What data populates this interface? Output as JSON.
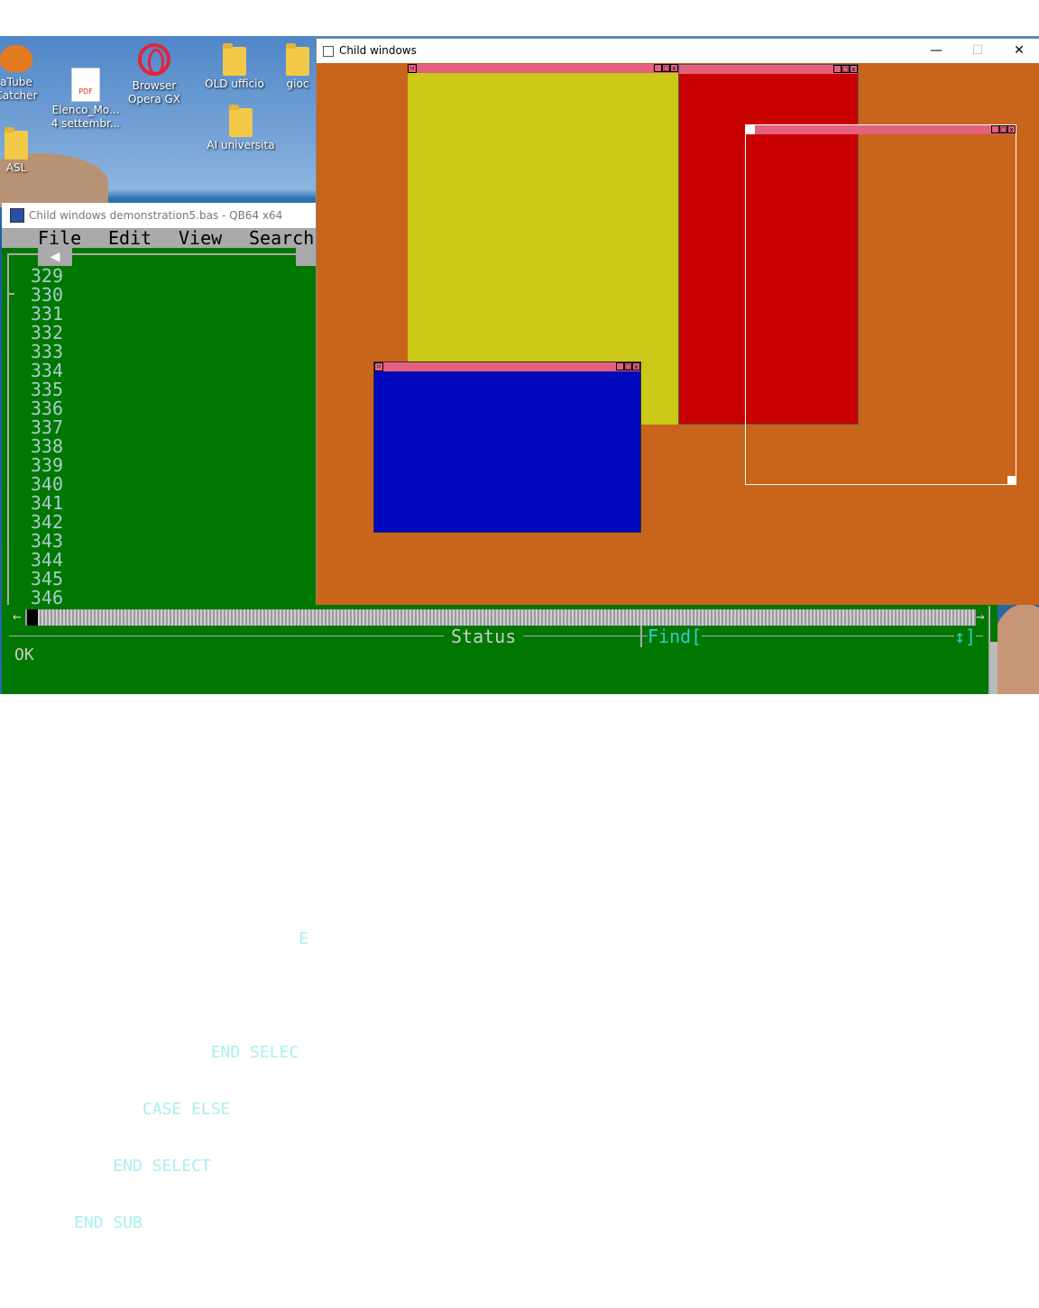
{
  "desktop": {
    "icons": [
      {
        "label": "aTube\nCatcher",
        "icon": "atube-icon"
      },
      {
        "label": "Elenco_Mo...\n4 settembr...",
        "icon": "pdf-icon"
      },
      {
        "label": "Browser\nOpera GX",
        "icon": "opera-icon"
      },
      {
        "label": "OLD ufficio",
        "icon": "folder-icon"
      },
      {
        "label": "gioc",
        "icon": "folder-icon"
      },
      {
        "label": "AI universita",
        "icon": "folder-icon"
      },
      {
        "label": "ASL",
        "icon": "folder-icon"
      }
    ]
  },
  "qb64": {
    "title": "Child windows demonstration5.bas - QB64 x64",
    "menu": [
      "File",
      "Edit",
      "View",
      "Search"
    ],
    "line_numbers": [
      "329",
      "330",
      "331",
      "332",
      "333",
      "334",
      "335",
      "336",
      "337",
      "338",
      "339",
      "340",
      "341",
      "342",
      "343",
      "344",
      "345",
      "346"
    ],
    "code_lines": [
      "",
      "",
      "",
      "",
      "",
      "",
      "",
      "",
      "",
      "",
      "",
      "                       E",
      "",
      "              END SELEC",
      "       CASE ELSE",
      "    END SELECT",
      "END SUB",
      ""
    ],
    "status_label": "Status",
    "find_label": "Find[",
    "find_end": "↕]",
    "ok_text": "OK",
    "scroll_left": "←",
    "scroll_right": "→",
    "tab_left": "◀"
  },
  "child_demo": {
    "title": "Child windows",
    "buttons": {
      "minimize": "—",
      "maximize": "☐",
      "close": "✕"
    },
    "colors": {
      "background": "#c8651b",
      "yellow": "#cbc817",
      "red": "#c90000",
      "blue": "#0008bb",
      "titlebar": "#e4607e"
    },
    "child_controls": {
      "system": "▫",
      "minimize": "_",
      "maximize": "□",
      "close": "x"
    }
  }
}
